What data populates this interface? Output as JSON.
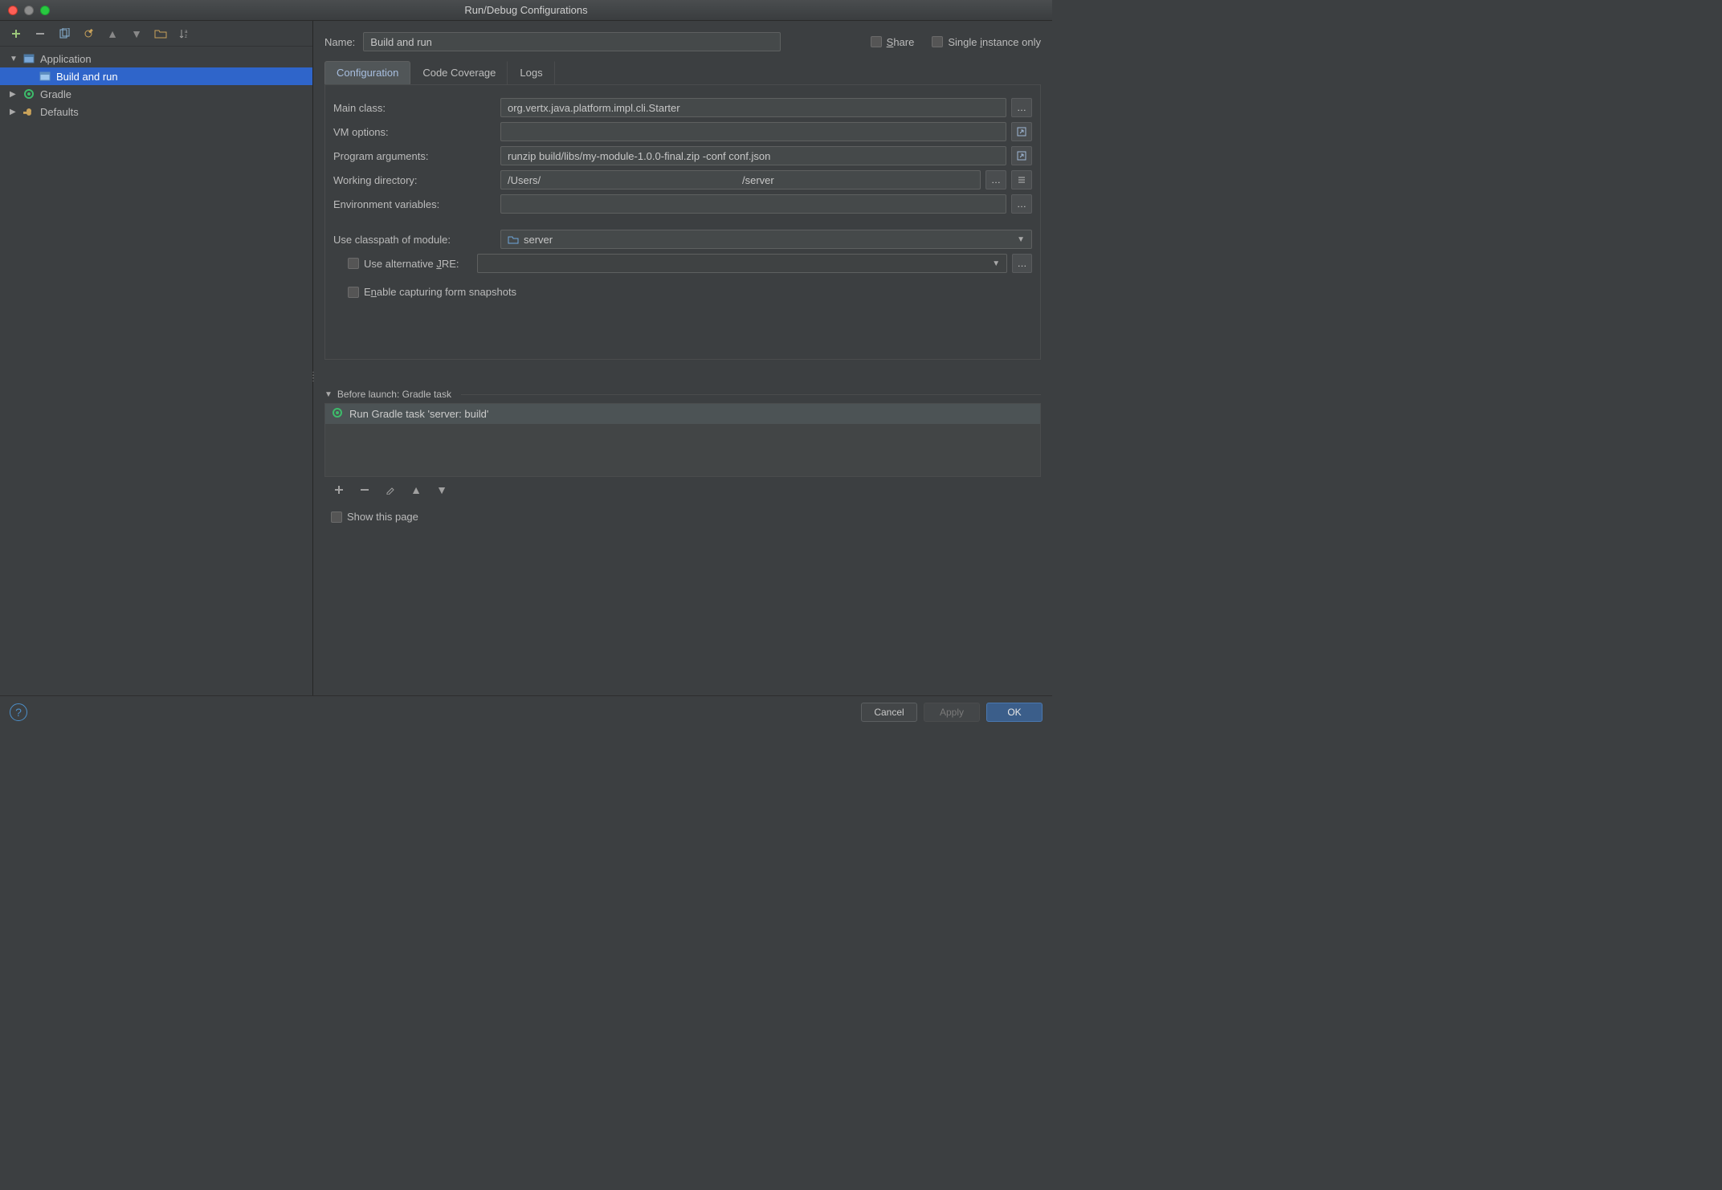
{
  "window": {
    "title": "Run/Debug Configurations"
  },
  "sidebar": {
    "items": [
      {
        "label": "Application",
        "expanded": true,
        "children": [
          {
            "label": "Build and run",
            "selected": true
          }
        ]
      },
      {
        "label": "Gradle",
        "expanded": false
      },
      {
        "label": "Defaults",
        "expanded": false
      }
    ]
  },
  "nameRow": {
    "label": "Name:",
    "value": "Build and run",
    "share": "Share",
    "singleInstance": "Single instance only"
  },
  "tabs": {
    "items": [
      "Configuration",
      "Code Coverage",
      "Logs"
    ],
    "activeIndex": 0
  },
  "form": {
    "mainClass": {
      "label": "Main class:",
      "value": "org.vertx.java.platform.impl.cli.Starter"
    },
    "vmOptions": {
      "label": "VM options:",
      "value": ""
    },
    "programArgs": {
      "label": "Program arguments:",
      "value": "runzip build/libs/my-module-1.0.0-final.zip -conf conf.json"
    },
    "workingDir": {
      "label": "Working directory:",
      "prefix": "/Users/",
      "suffix": "/server"
    },
    "envVars": {
      "label": "Environment variables:",
      "value": ""
    },
    "classpathModule": {
      "label": "Use classpath of module:",
      "value": "server"
    },
    "altJre": {
      "label": "Use alternative JRE:",
      "value": ""
    },
    "snapshots": {
      "label": "Enable capturing form snapshots"
    }
  },
  "beforeLaunch": {
    "header": "Before launch: Gradle task",
    "items": [
      "Run Gradle task 'server: build'"
    ],
    "showThisPage": "Show this page"
  },
  "footer": {
    "cancel": "Cancel",
    "apply": "Apply",
    "ok": "OK"
  }
}
